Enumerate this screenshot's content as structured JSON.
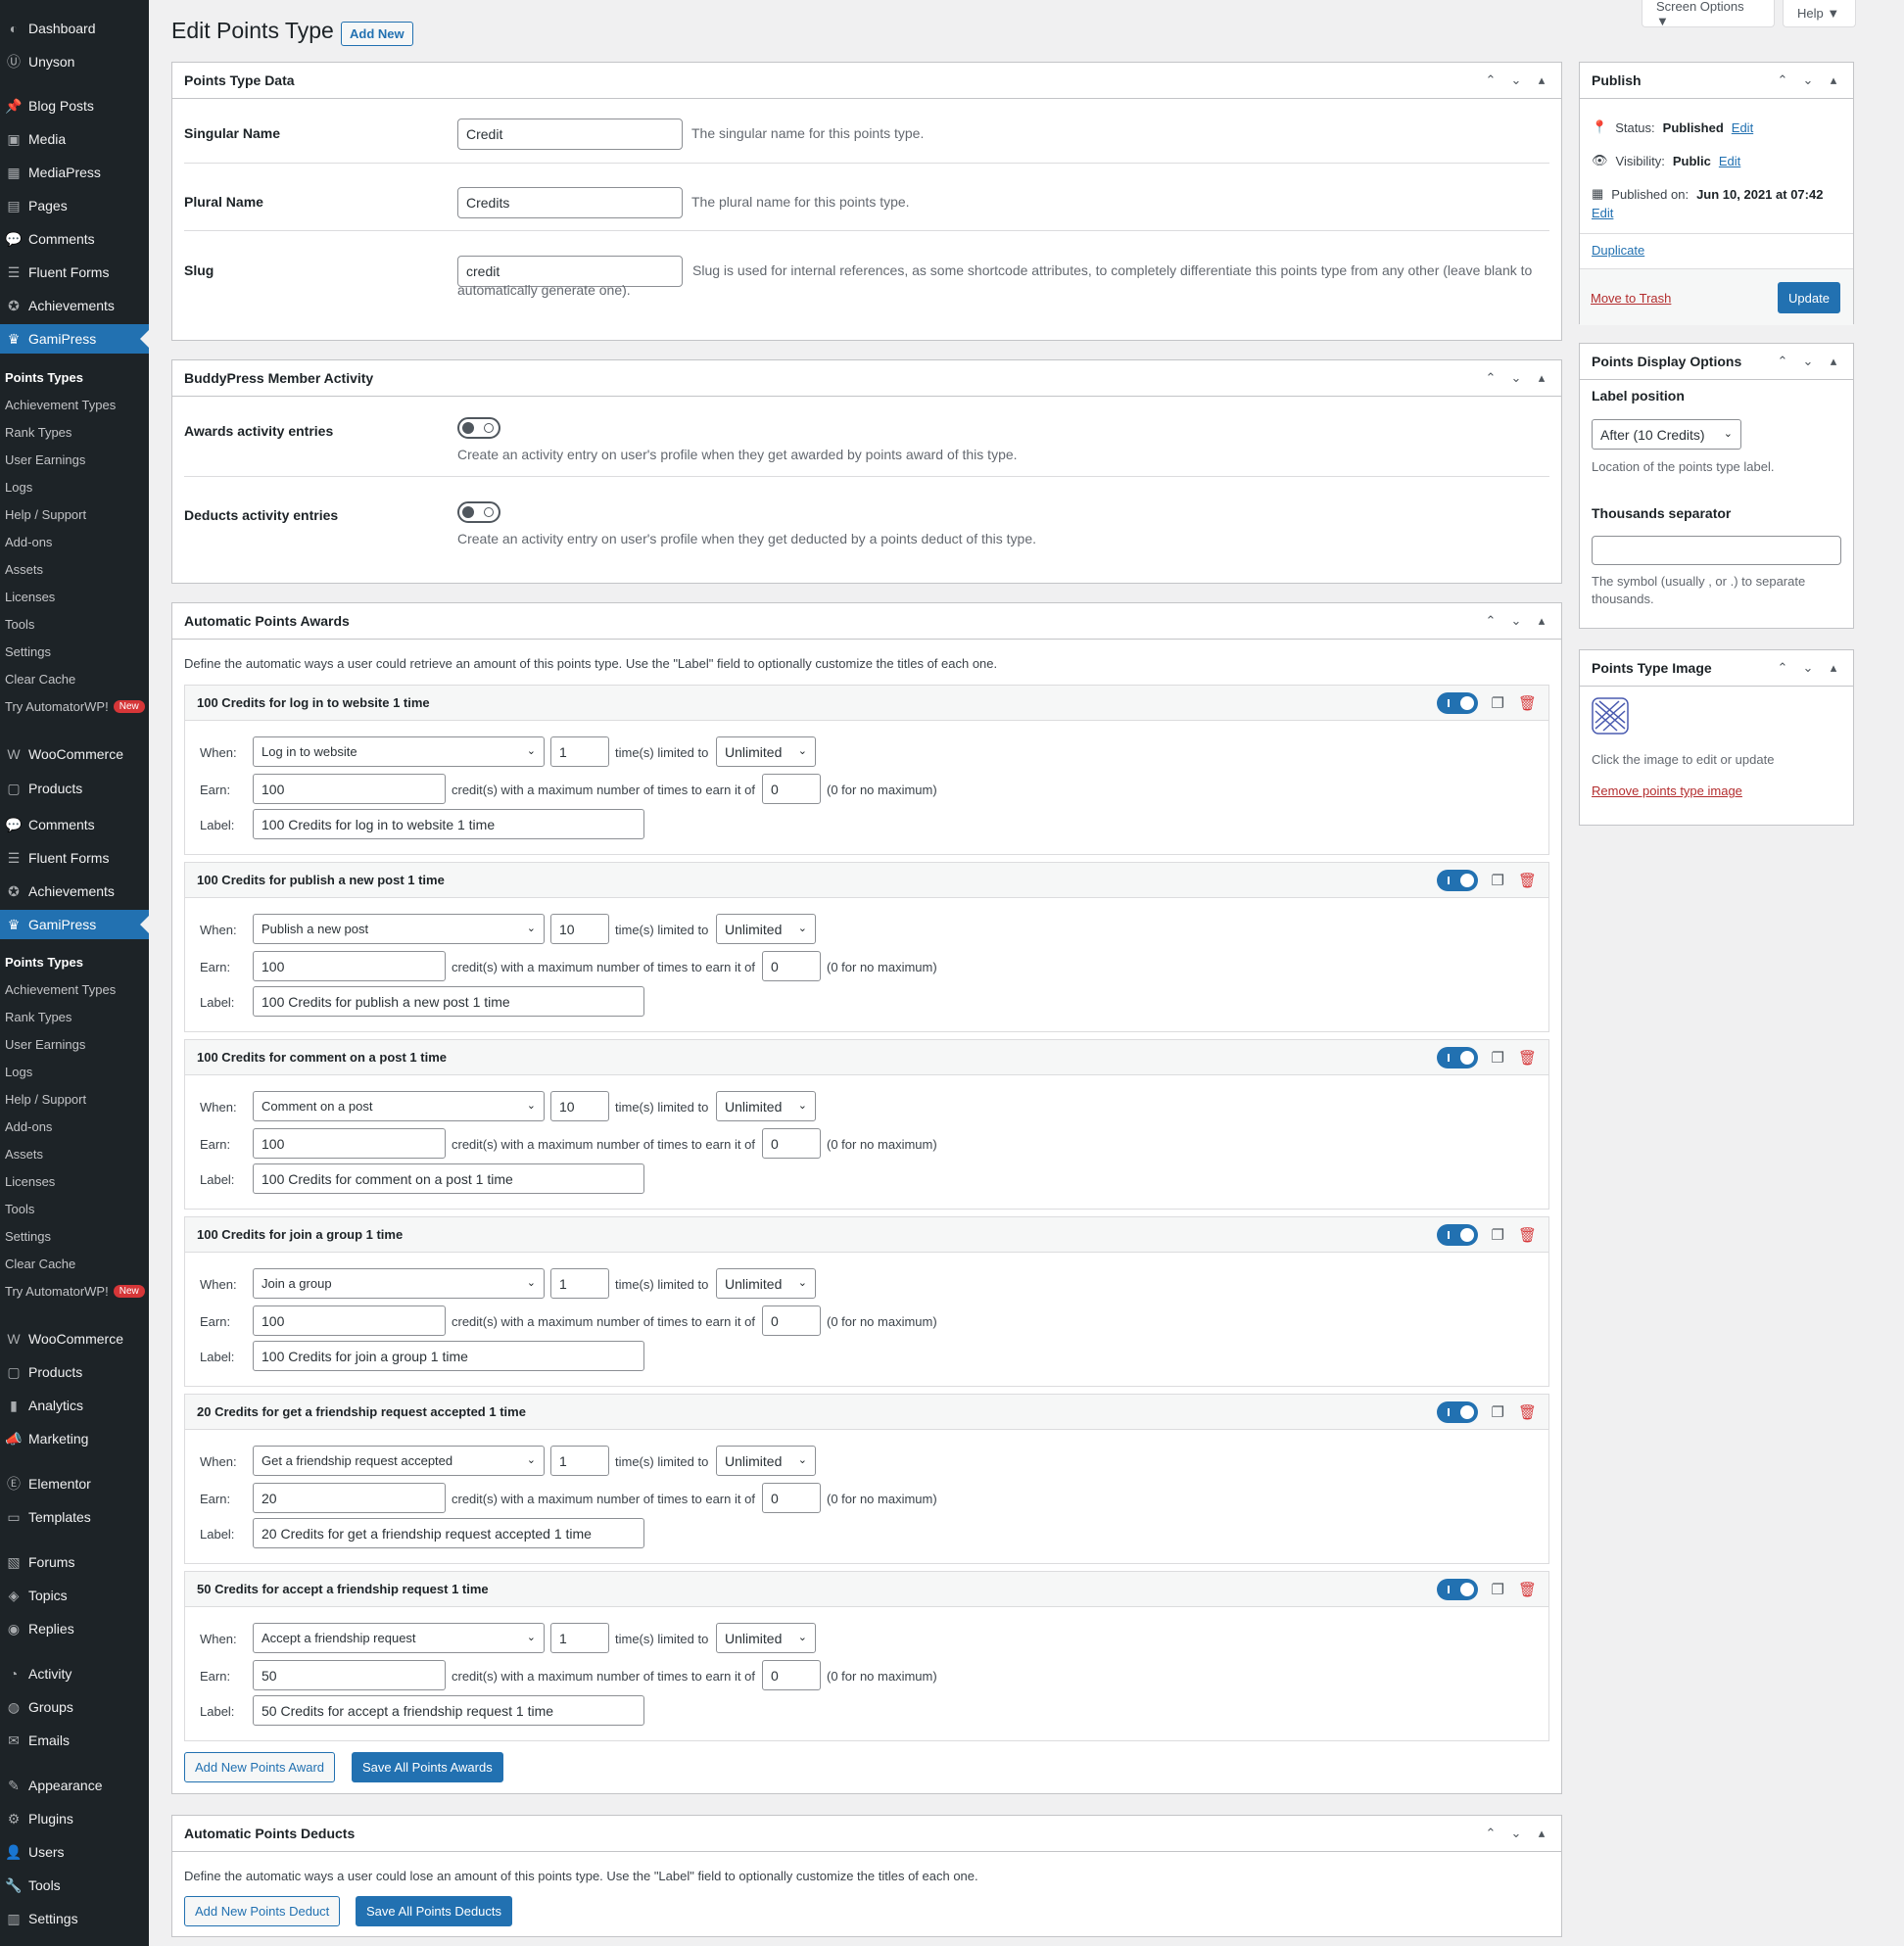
{
  "sidebar": {
    "group1": [
      {
        "label": "Dashboard",
        "icon": "dashboard-icon",
        "glyph": "◐"
      },
      {
        "label": "Unyson",
        "icon": "unyson-icon",
        "glyph": "Ⓤ"
      },
      {
        "label": "Blog Posts",
        "icon": "pin-icon",
        "glyph": "📌"
      },
      {
        "label": "Media",
        "icon": "media-icon",
        "glyph": "▣"
      },
      {
        "label": "MediaPress",
        "icon": "mediapress-icon",
        "glyph": "▦"
      },
      {
        "label": "Pages",
        "icon": "pages-icon",
        "glyph": "▤"
      },
      {
        "label": "Comments",
        "icon": "comments-icon",
        "glyph": "💬"
      },
      {
        "label": "Fluent Forms",
        "icon": "forms-icon",
        "glyph": "☰"
      },
      {
        "label": "Achievements",
        "icon": "achievements-icon",
        "glyph": "✪"
      },
      {
        "label": "GamiPress",
        "icon": "crown-icon",
        "glyph": "♛"
      }
    ],
    "sub1": [
      "Points Types",
      "Achievement Types",
      "Rank Types",
      "User Earnings",
      "Logs",
      "Help / Support",
      "Add-ons",
      "Assets",
      "Licenses",
      "Tools",
      "Settings",
      "Clear Cache",
      "Try AutomatorWP!"
    ],
    "group2": [
      {
        "label": "WooCommerce",
        "icon": "woocommerce-icon",
        "glyph": "W"
      },
      {
        "label": "Products",
        "icon": "products-icon",
        "glyph": "▢"
      },
      {
        "label": "Comments",
        "icon": "comments-icon",
        "glyph": "💬"
      },
      {
        "label": "Fluent Forms",
        "icon": "forms-icon",
        "glyph": "☰"
      },
      {
        "label": "Achievements",
        "icon": "achievements-icon",
        "glyph": "✪"
      },
      {
        "label": "GamiPress",
        "icon": "crown-icon",
        "glyph": "♛"
      }
    ],
    "sub2": [
      "Points Types",
      "Achievement Types",
      "Rank Types",
      "User Earnings",
      "Logs",
      "Help / Support",
      "Add-ons",
      "Assets",
      "Licenses",
      "Tools",
      "Settings",
      "Clear Cache",
      "Try AutomatorWP!"
    ],
    "group3": [
      {
        "label": "WooCommerce",
        "icon": "woocommerce-icon",
        "glyph": "W"
      },
      {
        "label": "Products",
        "icon": "products-icon",
        "glyph": "▢"
      },
      {
        "label": "Analytics",
        "icon": "analytics-icon",
        "glyph": "▮"
      },
      {
        "label": "Marketing",
        "icon": "megaphone-icon",
        "glyph": "📣"
      },
      {
        "label": "Elementor",
        "icon": "elementor-icon",
        "glyph": "Ⓔ"
      },
      {
        "label": "Templates",
        "icon": "folder-icon",
        "glyph": "▭"
      },
      {
        "label": "Forums",
        "icon": "forums-icon",
        "glyph": "▧"
      },
      {
        "label": "Topics",
        "icon": "topics-icon",
        "glyph": "◈"
      },
      {
        "label": "Replies",
        "icon": "replies-icon",
        "glyph": "◉"
      },
      {
        "label": "Activity",
        "icon": "activity-icon",
        "glyph": "◔"
      },
      {
        "label": "Groups",
        "icon": "groups-icon",
        "glyph": "◍"
      },
      {
        "label": "Emails",
        "icon": "emails-icon",
        "glyph": "✉"
      },
      {
        "label": "Appearance",
        "icon": "appearance-icon",
        "glyph": "✎"
      },
      {
        "label": "Plugins",
        "icon": "plugins-icon",
        "glyph": "⚙"
      },
      {
        "label": "Users",
        "icon": "users-icon",
        "glyph": "👤"
      },
      {
        "label": "Tools",
        "icon": "tools-icon",
        "glyph": "🔧"
      },
      {
        "label": "Settings",
        "icon": "settings-icon",
        "glyph": "▥"
      }
    ],
    "new_badge": "New"
  },
  "top": {
    "screen_options": "Screen Options ▼",
    "help": "Help ▼"
  },
  "header": {
    "title": "Edit Points Type",
    "add_new": "Add New"
  },
  "points_type_data": {
    "title": "Points Type Data",
    "singular_label": "Singular Name",
    "singular_value": "Credit",
    "singular_desc": "The singular name for this points type.",
    "plural_label": "Plural Name",
    "plural_value": "Credits",
    "plural_desc": "The plural name for this points type.",
    "slug_label": "Slug",
    "slug_value": "credit",
    "slug_desc": "Slug is used for internal references, as some shortcode attributes, to completely differentiate this points type from any other (leave blank to automatically generate one)."
  },
  "buddypress": {
    "title": "BuddyPress Member Activity",
    "awards_label": "Awards activity entries",
    "awards_desc": "Create an activity entry on user's profile when they get awarded by points award of this type.",
    "deducts_label": "Deducts activity entries",
    "deducts_desc": "Create an activity entry on user's profile when they get deducted by a points deduct of this type."
  },
  "awards": {
    "title": "Automatic Points Awards",
    "intro": "Define the automatic ways a user could retrieve an amount of this points type. Use the \"Label\" field to optionally customize the titles of each one.",
    "when_label": "When:",
    "earn_label": "Earn:",
    "label_label": "Label:",
    "times_limited": "time(s) limited to",
    "max_text": "credit(s) with a maximum number of times to earn it of",
    "no_max": "(0 for no maximum)",
    "items": [
      {
        "title": "100 Credits for log in to website 1 time",
        "when": "Log in to website",
        "times": "1",
        "limit": "Unlimited",
        "earn": "100",
        "max": "0",
        "label": "100 Credits for log in to website 1 time"
      },
      {
        "title": "100 Credits for publish a new post 1 time",
        "when": "Publish a new post",
        "times": "10",
        "limit": "Unlimited",
        "earn": "100",
        "max": "0",
        "label": "100 Credits for publish a new post 1 time"
      },
      {
        "title": "100 Credits for comment on a post 1 time",
        "when": "Comment on a post",
        "times": "10",
        "limit": "Unlimited",
        "earn": "100",
        "max": "0",
        "label": "100 Credits for comment on a post 1 time"
      },
      {
        "title": "100 Credits for join a group 1 time",
        "when": "Join a group",
        "times": "1",
        "limit": "Unlimited",
        "earn": "100",
        "max": "0",
        "label": "100 Credits for join a group 1 time"
      },
      {
        "title": "20 Credits for get a friendship request accepted 1 time",
        "when": "Get a friendship request accepted",
        "times": "1",
        "limit": "Unlimited",
        "earn": "20",
        "max": "0",
        "label": "20 Credits for get a friendship request accepted 1 time"
      },
      {
        "title": "50 Credits for accept a friendship request 1 time",
        "when": "Accept a friendship request",
        "times": "1",
        "limit": "Unlimited",
        "earn": "50",
        "max": "0",
        "label": "50 Credits for accept a friendship request 1 time"
      }
    ],
    "add_btn": "Add New Points Award",
    "save_btn": "Save All Points Awards"
  },
  "deducts": {
    "title": "Automatic Points Deducts",
    "intro": "Define the automatic ways a user could lose an amount of this points type. Use the \"Label\" field to optionally customize the titles of each one.",
    "add_btn": "Add New Points Deduct",
    "save_btn": "Save All Points Deducts"
  },
  "publish": {
    "title": "Publish",
    "status_label": "Status:",
    "status_value": "Published",
    "edit": "Edit",
    "visibility_label": "Visibility:",
    "visibility_value": "Public",
    "published_label": "Published on:",
    "published_value": "Jun 10, 2021 at 07:42",
    "duplicate": "Duplicate",
    "trash": "Move to Trash",
    "update": "Update"
  },
  "display": {
    "title": "Points Display Options",
    "label_position": "Label position",
    "label_position_value": "After (10 Credits)",
    "label_position_desc": "Location of the points type label.",
    "thousands": "Thousands separator",
    "thousands_value": "",
    "thousands_desc": "The symbol (usually , or .) to separate thousands."
  },
  "image": {
    "title": "Points Type Image",
    "desc": "Click the image to edit or update",
    "remove": "Remove points type image"
  },
  "colors": {
    "accent": "#2271b1",
    "sidebar": "#1d2327",
    "danger": "#d63638"
  }
}
